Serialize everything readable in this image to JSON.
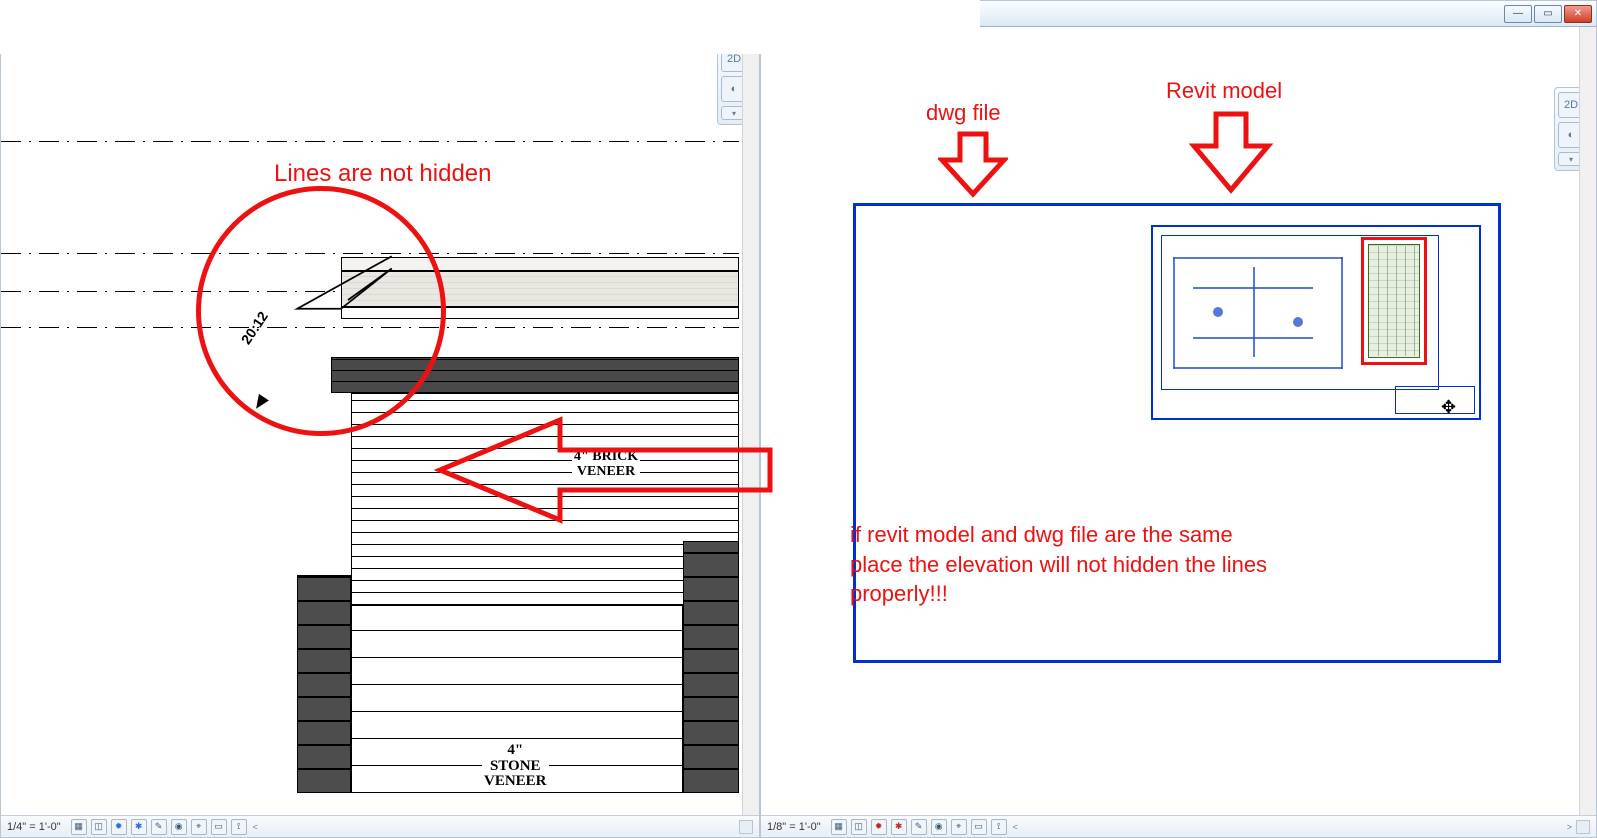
{
  "window": {
    "minimize_glyph": "—",
    "maximize_glyph": "▭",
    "close_glyph": "✕"
  },
  "left": {
    "scale": "1/4\" = 1'-0\"",
    "nav": {
      "mode": "2D"
    },
    "annotations": {
      "headline": "Lines are not hidden",
      "slope": "20:12",
      "brick_l1": "4\" BRICK",
      "brick_l2": "VENEER",
      "stone_l1": "4\"",
      "stone_l2": "STONE",
      "stone_l3": "VENEER"
    }
  },
  "right": {
    "scale": "1/8\" = 1'-0\"",
    "nav": {
      "mode": "2D"
    },
    "labels": {
      "dwg": "dwg file",
      "revit": "Revit model",
      "note_l1": "if revit model and dwg file are the same",
      "note_l2": "place the elevation will not hidden the lines",
      "note_l3": "properly!!!"
    }
  },
  "status_icons": {
    "a": "▦",
    "b": "◫",
    "c": "✹",
    "d": "✱",
    "e": "✎",
    "f": "◉",
    "g": "⌖",
    "h": "▭",
    "i": "⟟"
  }
}
